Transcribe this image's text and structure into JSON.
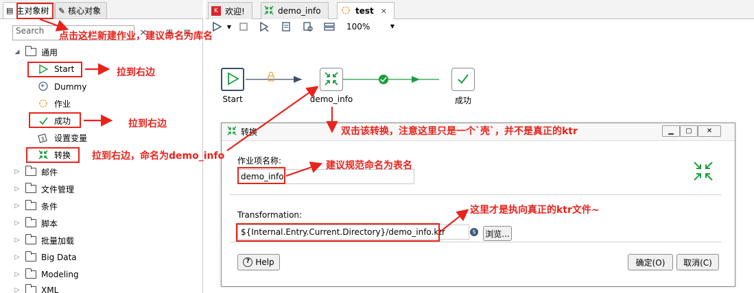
{
  "left_tabs": {
    "main_tree": "主对象树",
    "core_objects": "核心对象"
  },
  "search": {
    "placeholder": "Search"
  },
  "tree": {
    "general": "通用",
    "start": "Start",
    "dummy": "Dummy",
    "job": "作业",
    "success": "成功",
    "set_variables": "设置变量",
    "transformation": "转换",
    "mail": "邮件",
    "file_management": "文件管理",
    "conditions": "条件",
    "scripting": "脚本",
    "bulk_loading": "批量加载",
    "big_data": "Big Data",
    "modeling": "Modeling",
    "xml": "XML"
  },
  "right_tabs": {
    "welcome": "欢迎!",
    "demo_info": "demo_info",
    "test": "test"
  },
  "toolbar": {
    "zoom": "100%"
  },
  "canvas": {
    "start_label": "Start",
    "trans_label": "demo_info",
    "success_label": "成功"
  },
  "dialog": {
    "title": "转换",
    "entry_name_label": "作业项名称:",
    "entry_name_value": "demo_info",
    "transformation_label": "Transformation:",
    "transformation_path": "${Internal.Entry.Current.Directory}/demo_info.ktr",
    "browse": "浏览...",
    "help": "Help",
    "ok": "确定(O)",
    "cancel": "取消(C)"
  },
  "annotations": {
    "a1": "点击这栏新建作业，建议命名为库名",
    "a2": "拉到右边",
    "a3": "拉到右边",
    "a4": "拉到右边，命名为demo_info",
    "a5": "双击该转换，注意这里只是一个`壳`，并不是真正的ktr",
    "a6": "建议规范命名为表名",
    "a7": "这里才是执向真正的ktr文件~"
  },
  "colors": {
    "annotation": "#e8231b",
    "success_green": "#1a9e3c",
    "flow_blue": "#3a4f6b"
  }
}
